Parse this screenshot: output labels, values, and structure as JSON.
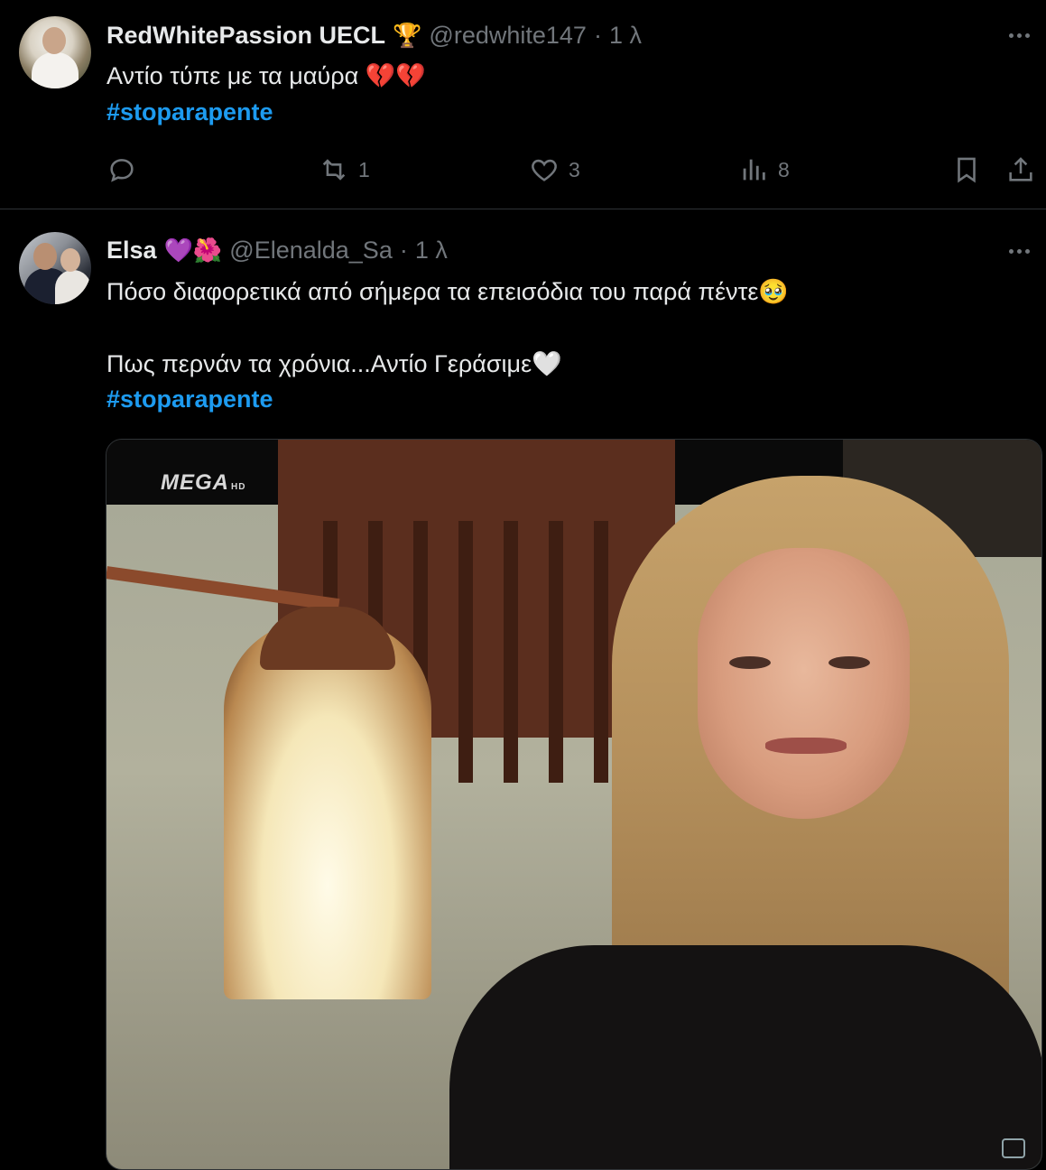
{
  "tweets": [
    {
      "author_name": "RedWhitePassion UECL",
      "author_badge_emoji": "🏆",
      "handle": "@redwhite147",
      "separator": "·",
      "time": "1 λ",
      "lines": [
        "Αντίο τύπε με τα μαύρα 💔💔"
      ],
      "hashtag": "#stoparapente",
      "actions": {
        "reply_count": "",
        "retweet_count": "1",
        "like_count": "3",
        "views_count": "8"
      }
    },
    {
      "author_name": "Elsa",
      "author_badge_emoji": "💜🌺",
      "handle": "@Elenalda_Sa",
      "separator": "·",
      "time": "1 λ",
      "lines": [
        "Πόσο διαφορετικά από σήμερα τα επεισόδια του παρά πέντε🥹",
        "",
        "Πως περνάν τα χρόνια...Αντίο Γεράσιμε🤍"
      ],
      "hashtag": "#stoparapente",
      "media": {
        "logo_text": "MEGA",
        "logo_suffix": "HD"
      }
    }
  ],
  "icons": {
    "reply": "reply-icon",
    "retweet": "retweet-icon",
    "like": "heart-icon",
    "views": "views-icon",
    "bookmark": "bookmark-icon",
    "share": "share-icon",
    "more": "more-icon"
  },
  "colors": {
    "background": "#000000",
    "text": "#e7e9ea",
    "muted": "#71767b",
    "hashtag": "#1d9bf0",
    "divider": "#2f3336"
  }
}
